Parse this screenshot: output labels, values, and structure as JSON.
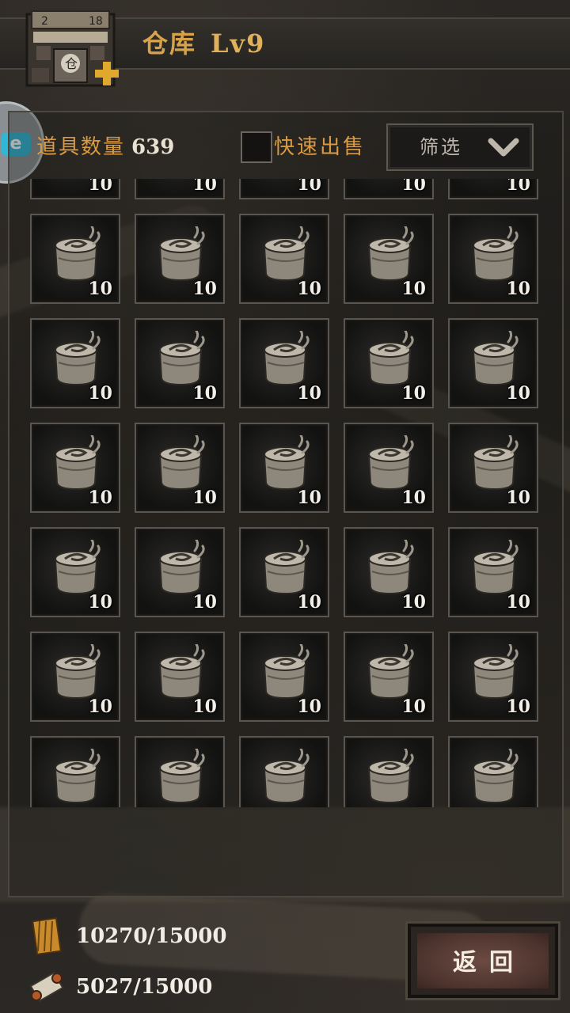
{
  "header": {
    "title": "仓库",
    "level": "Lv9",
    "building_icon": "warehouse-building-icon",
    "upgrade_icon": "plus-icon"
  },
  "side_badge": {
    "label": "e"
  },
  "toolbar": {
    "item_count_label": "道具数量",
    "item_count": "639",
    "quick_sell_label": "快速出售",
    "filter_label": "筛选",
    "filter_icon": "chevron-down-icon"
  },
  "grid": {
    "item_icon": "rope-spool-icon",
    "rows": [
      [
        "10",
        "10",
        "10",
        "10",
        "10"
      ],
      [
        "10",
        "10",
        "10",
        "10",
        "10"
      ],
      [
        "10",
        "10",
        "10",
        "10",
        "10"
      ],
      [
        "10",
        "10",
        "10",
        "10",
        "10"
      ],
      [
        "10",
        "10",
        "10",
        "10",
        "10"
      ],
      [
        "10",
        "10",
        "10",
        "10",
        "10"
      ],
      [
        "",
        "",
        "",
        "",
        ""
      ]
    ]
  },
  "resources": [
    {
      "icon": "bamboo-scroll-icon",
      "value": "10270/15000"
    },
    {
      "icon": "paper-scroll-icon",
      "value": "5027/15000"
    }
  ],
  "back_button": {
    "label": "返回"
  },
  "colors": {
    "accent": "#d99a43",
    "text_light": "#f1ede4",
    "background": "#1e1c1a"
  }
}
